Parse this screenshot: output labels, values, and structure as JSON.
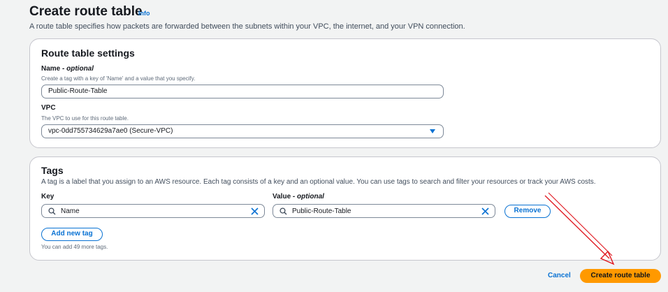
{
  "header": {
    "title": "Create route table",
    "info_link": "Info",
    "description": "A route table specifies how packets are forwarded between the subnets within your VPC, the internet, and your VPN connection."
  },
  "route_table_settings": {
    "title": "Route table settings",
    "name_label": "Name",
    "name_optional": "- optional",
    "name_hint": "Create a tag with a key of 'Name' and a value that you specify.",
    "name_value": "Public-Route-Table",
    "vpc_label": "VPC",
    "vpc_hint": "The VPC to use for this route table.",
    "vpc_selected": "vpc-0dd755734629a7ae0 (Secure-VPC)"
  },
  "tags": {
    "title": "Tags",
    "description": "A tag is a label that you assign to an AWS resource. Each tag consists of a key and an optional value. You can use tags to search and filter your resources or track your AWS costs.",
    "key_label": "Key",
    "value_label": "Value",
    "value_optional": "- optional",
    "rows": [
      {
        "key": "Name",
        "value": "Public-Route-Table",
        "remove_label": "Remove"
      }
    ],
    "add_tag_label": "Add new tag",
    "remaining_hint": "You can add 49 more tags."
  },
  "footer": {
    "cancel_label": "Cancel",
    "create_label": "Create route table"
  },
  "colors": {
    "accent": "#0972d3",
    "primary_button": "#ff9900",
    "annotation_arrow": "#e0161e"
  },
  "icons": [
    "search-icon",
    "clear-icon",
    "caret-down-icon",
    "annotation-arrow"
  ]
}
